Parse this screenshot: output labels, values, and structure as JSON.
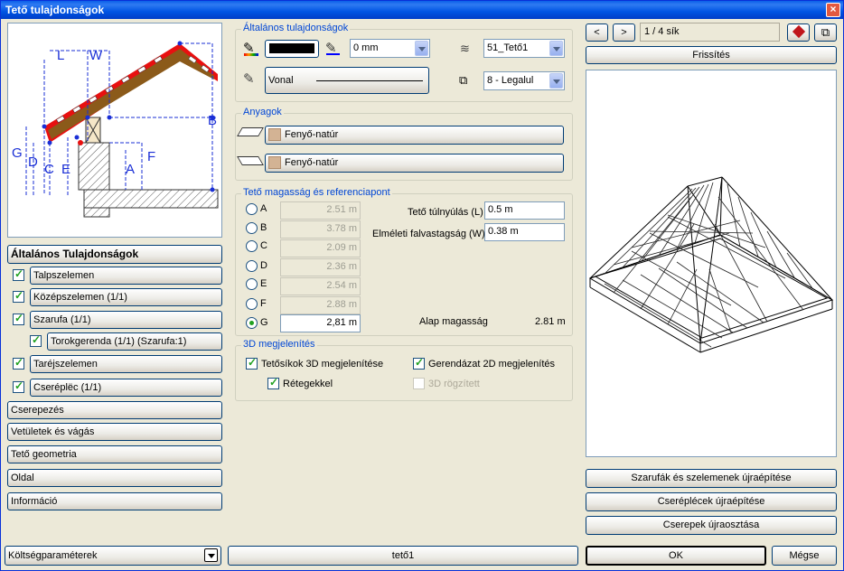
{
  "window": {
    "title": "Tető tulajdonságok",
    "close": "×"
  },
  "diagram_labels": {
    "L": "L",
    "W": "W",
    "B": "B",
    "G": "G",
    "D": "D",
    "C": "C",
    "E": "E",
    "A": "A",
    "F": "F"
  },
  "sidebar": {
    "header": "Általános Tulajdonságok",
    "items": [
      {
        "label": "Talpszelemen",
        "checked": true
      },
      {
        "label": "Középszelemen (1/1)",
        "checked": true
      },
      {
        "label": "Szarufa (1/1)",
        "checked": true
      },
      {
        "label": "Torokgerenda (1/1) (Szarufa:1)",
        "checked": true
      },
      {
        "label": "Taréjszelemen",
        "checked": true
      },
      {
        "label": "Cseréplëc (1/1)",
        "checked": true
      }
    ],
    "sections": [
      "Cserepezés",
      "Vetületek és vágás",
      "Tető geometria",
      "Oldal",
      "Információ"
    ]
  },
  "general": {
    "legend": "Általános tulajdonságok",
    "pen_thickness": "0 mm",
    "layer": "51_Tető1",
    "line_type": "Vonal",
    "priority": "8 - Legalul"
  },
  "materials": {
    "legend": "Anyagok",
    "top": "Fenyő-natúr",
    "bottom": "Fenyő-natúr"
  },
  "height": {
    "legend": "Tető magasság és referenciapont",
    "refs": [
      {
        "id": "A",
        "value": "2.51 m",
        "selected": false
      },
      {
        "id": "B",
        "value": "3.78 m",
        "selected": false
      },
      {
        "id": "C",
        "value": "2.09 m",
        "selected": false
      },
      {
        "id": "D",
        "value": "2.36 m",
        "selected": false
      },
      {
        "id": "E",
        "value": "2.54 m",
        "selected": false
      },
      {
        "id": "F",
        "value": "2.88 m",
        "selected": false
      },
      {
        "id": "G",
        "value": "2,81 m",
        "selected": true
      }
    ],
    "overhang_label": "Tető túlnyúlás (L)",
    "overhang_value": "0.5 m",
    "wall_label": "Elméleti falvastagság (W)",
    "wall_value": "0.38 m",
    "base_label": "Alap magasság",
    "base_value": "2.81 m"
  },
  "display3d": {
    "legend": "3D megjelenítés",
    "planes3d": "Tetősíkok 3D megjelenítése",
    "beams2d": "Gerendázat 2D megjelenítés",
    "layers": "Rétegekkel",
    "fixed3d": "3D rögzített"
  },
  "preview": {
    "prev": "<",
    "next": ">",
    "plane_counter": "1 / 4 sík",
    "refresh": "Frissítés",
    "rebuild_rafters": "Szarufák és szelemenek újraépítése",
    "rebuild_battens": "Cseréplécek újraépítése",
    "redistribute_tiles": "Cserepek újraosztása"
  },
  "footer": {
    "cost_params": "Költségparaméterek",
    "roof_name": "tető1",
    "ok": "OK",
    "cancel": "Mégse"
  },
  "colors": {
    "title_blue": "#0054e3",
    "roof_red": "#e81010",
    "timber": "#8b5a1a",
    "swatch": "#d3b394"
  }
}
